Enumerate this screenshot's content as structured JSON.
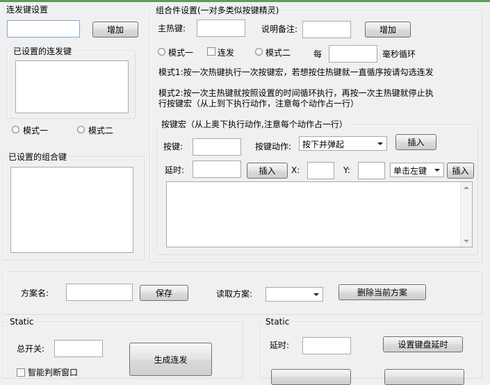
{
  "repeat_key": {
    "title": "连发键设置",
    "add_label": "增加",
    "set_keys_title": "已设置的连发键",
    "mode1_label": "模式一",
    "mode2_label": "模式二"
  },
  "combo_keys": {
    "title": "已设置的组合键"
  },
  "combo": {
    "title": "组合件设置(一对多类似按键精灵)",
    "hotkey_label": "主热键:",
    "note_label": "说明备注:",
    "add_label": "增加",
    "mode1_label": "模式一",
    "repeat_label": "连发",
    "mode2_label": "模式二",
    "every_label": "每",
    "ms_loop_label": "毫秒循环",
    "mode1_desc": "模式1:按一次热键执行一次按键宏，若想按住热键就一直循序按请勾选连发",
    "mode2_desc_line1": "模式2:按一次主热键就按照设置的时间循环执行，再按一次主热键就停止执",
    "mode2_desc_line2": "行按键宏（从上到下执行动作，注意每个动作占一行）"
  },
  "macro": {
    "title": "按键宏（从上奥下执行动作,注意每个动作占一行）",
    "key_label": "按键:",
    "action_label": "按键动作:",
    "action_value": "按下并弹起",
    "insert_label": "插入",
    "delay_label": "延时:",
    "x_label": "X:",
    "y_label": "Y:",
    "click_value": "单击左键"
  },
  "scheme": {
    "name_label": "方案名:",
    "save_label": "保存",
    "load_label": "读取方案:",
    "delete_label": "删除当前方案"
  },
  "static_left": {
    "title": "Static",
    "master_switch_label": "总开关:",
    "generate_label": "生成连发",
    "smart_window_label": "智能判断窗口"
  },
  "static_right": {
    "title": "Static",
    "delay_label": "延时:",
    "set_delay_label": "设置键盘延时"
  }
}
